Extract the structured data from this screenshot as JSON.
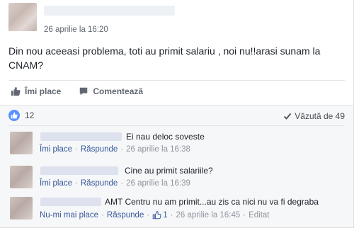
{
  "post": {
    "author_name": "",
    "timestamp": "26 aprilie la 16:20",
    "text_line1": "Din nou aceeasi problema, toti au primit salariu , noi nu!!arasi sunam la",
    "text_line2": "CNAM?"
  },
  "actions": {
    "like_label": "Îmi place",
    "comment_label": "Comentează"
  },
  "summary": {
    "like_count": "12",
    "seen_label": "Văzută de 49"
  },
  "comments": [
    {
      "text": "Ei nau deloc soveste",
      "like_label": "Îmi place",
      "reply_label": "Răspunde",
      "timestamp": "26 aprilie la 16:38"
    },
    {
      "text": "Cine au primit salariile?",
      "like_label": "Îmi place",
      "reply_label": "Răspunde",
      "timestamp": "26 aprilie la 16:39"
    },
    {
      "text": "AMT Centru nu am primit...au zis ca nici nu va fi degraba",
      "like_label": "Nu-mi mai place",
      "reply_label": "Răspunde",
      "like_count": "1",
      "timestamp": "26 aprilie la 16:45",
      "edited_label": "Editat"
    }
  ],
  "colors": {
    "link": "#365899",
    "like_blue": "#5890ff",
    "meta_gray": "#90949c"
  },
  "icons": {
    "like": "thumbs-up-icon",
    "comment": "speech-bubble-icon",
    "seen": "checkmark-icon"
  }
}
